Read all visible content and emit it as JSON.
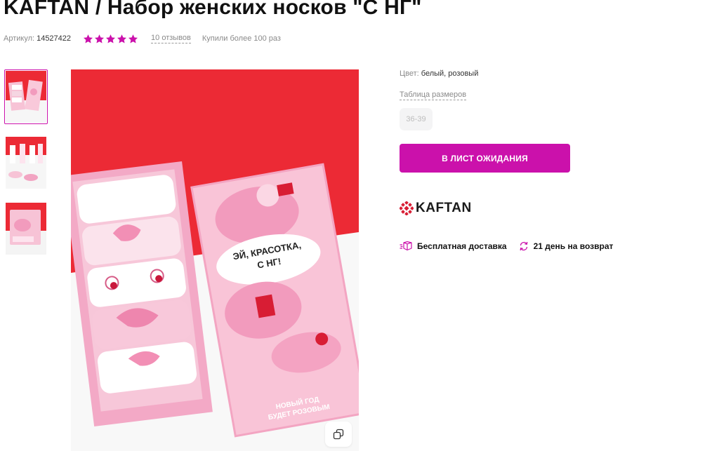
{
  "title": "KAFTAN / Набор женских носков \"С НГ\"",
  "meta": {
    "article_label": "Артикул:",
    "article_value": "14527422",
    "rating_stars": 5,
    "reviews": "10 отзывов",
    "bought": "Купили более 100 раз"
  },
  "colors": {
    "star": "#cb11ab",
    "accent": "#cb11ab",
    "background_red": "#ec2a35"
  },
  "gallery": {
    "thumbnails": [
      {
        "icon": "product-photo-box"
      },
      {
        "icon": "product-photo-socks"
      },
      {
        "icon": "product-photo-box-side"
      }
    ],
    "active_index": 0,
    "box_text_1": "ЭЙ, КРАСОТКА,",
    "box_text_2": "С НГ!",
    "box_text_3": "НОВЫЙ ГОД",
    "box_text_4": "БУДЕТ РОЗОВЫМ"
  },
  "details": {
    "color_label": "Цвет:",
    "color_value": "белый, розовый",
    "size_table": "Таблица размеров",
    "size": "36-39",
    "wait_button": "В ЛИСТ ОЖИДАНИЯ",
    "brand": "KAFTAN",
    "free_delivery": "Бесплатная доставка",
    "return": "21 день на возврат"
  }
}
